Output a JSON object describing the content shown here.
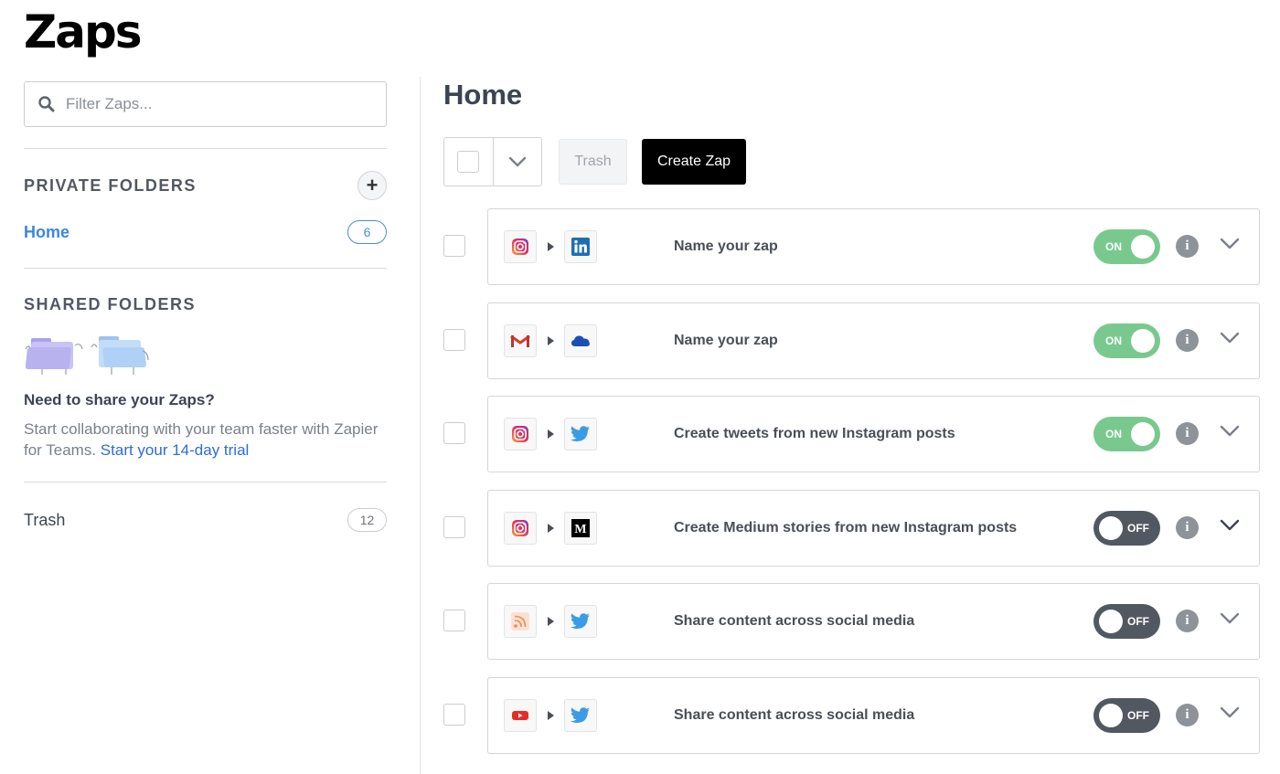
{
  "page_title": "Zaps",
  "sidebar": {
    "search_placeholder": "Filter Zaps...",
    "private_title": "PRIVATE FOLDERS",
    "add_symbol": "+",
    "home_label": "Home",
    "home_count": "6",
    "shared_title": "SHARED FOLDERS",
    "share_heading": "Need to share your Zaps?",
    "share_text": "Start collaborating with your team faster with Zapier for Teams.",
    "share_link": "Start your 14-day trial",
    "trash_label": "Trash",
    "trash_count": "12"
  },
  "main": {
    "title": "Home",
    "trash_button": "Trash",
    "create_button": "Create Zap"
  },
  "zaps": [
    {
      "name": "Name your zap",
      "trigger_icon": "instagram-icon",
      "action_icon": "linkedin-icon",
      "status": "ON"
    },
    {
      "name": "Name your zap",
      "trigger_icon": "gmail-icon",
      "action_icon": "onedrive-icon",
      "status": "ON"
    },
    {
      "name": "Create tweets from new Instagram posts",
      "trigger_icon": "instagram-icon",
      "action_icon": "twitter-icon",
      "status": "ON"
    },
    {
      "name": "Create Medium stories from new Instagram posts",
      "trigger_icon": "instagram-icon",
      "action_icon": "medium-icon",
      "status": "OFF"
    },
    {
      "name": "Share content across social media",
      "trigger_icon": "rss-icon",
      "action_icon": "twitter-icon",
      "status": "OFF"
    },
    {
      "name": "Share content across social media",
      "trigger_icon": "youtube-icon",
      "action_icon": "twitter-icon",
      "status": "OFF"
    }
  ],
  "colors": {
    "accent_blue": "#3e86dd",
    "toggle_on": "#79c98e",
    "toggle_off": "#525861",
    "create_button": "#000000"
  }
}
